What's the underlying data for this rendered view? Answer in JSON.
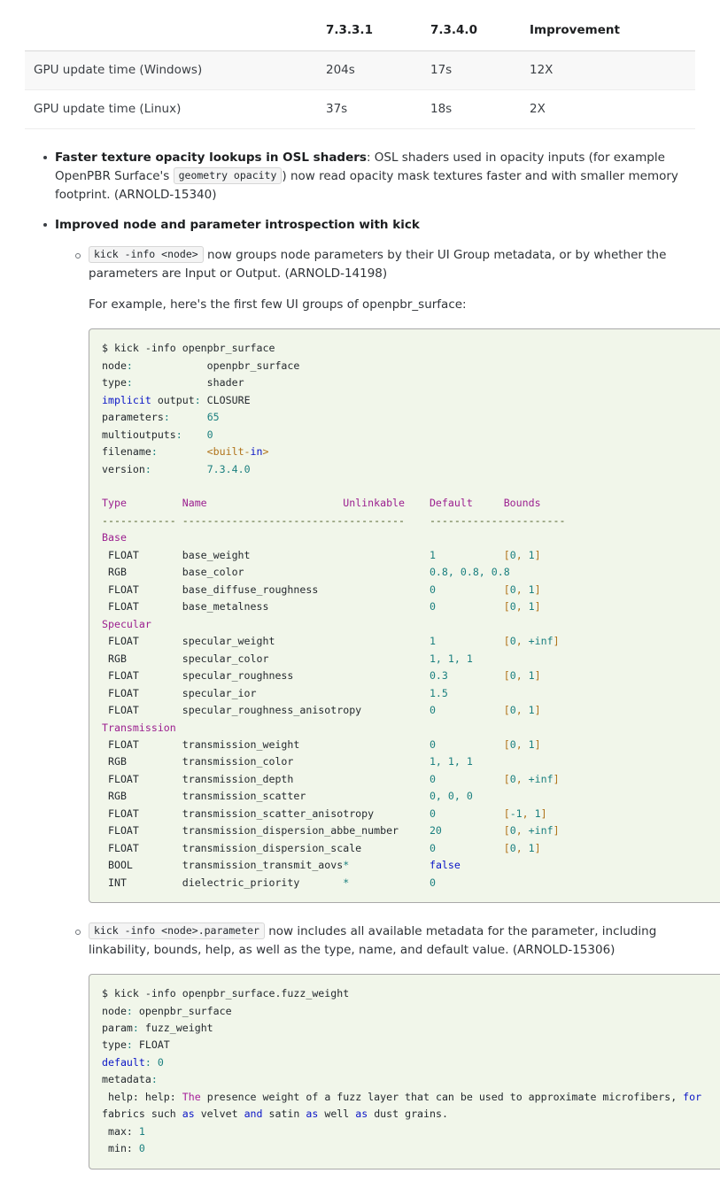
{
  "perf_table": {
    "headers": [
      "",
      "7.3.3.1",
      "7.3.4.0",
      "Improvement"
    ],
    "rows": [
      {
        "label": "GPU update time (Windows)",
        "v1": "204s",
        "v2": "17s",
        "improvement": "12X"
      },
      {
        "label": "GPU update time (Linux)",
        "v1": "37s",
        "v2": "18s",
        "improvement": "2X"
      }
    ]
  },
  "bullets": {
    "item1": {
      "title": "Faster texture opacity lookups in OSL shaders",
      "text_a": ": OSL shaders used in opacity inputs (for example OpenPBR Surface's ",
      "chip": "geometry opacity",
      "text_b": ") now read opacity mask textures faster and with smaller memory footprint. (ARNOLD-15340)"
    },
    "item2": {
      "title": "Improved node and parameter introspection with kick",
      "sub1": {
        "chip": "kick -info <node>",
        "text": " now groups node parameters by their UI Group metadata, or by whether the parameters are Input or Output. (ARNOLD-14198)",
        "para": "For example, here's the first few UI groups of openpbr_surface:"
      },
      "sub2": {
        "chip": "kick -info <node>.parameter",
        "text": " now includes all available metadata for the parameter, including linkability, bounds, help, as well as the type, name, and default value. (ARNOLD-15306)"
      }
    }
  },
  "code_block_1": {
    "command": "$ kick -info openpbr_surface",
    "info": [
      {
        "key": "node:",
        "value": "openpbr_surface",
        "kind": "plain"
      },
      {
        "key": "type:",
        "value": "shader",
        "kind": "plain"
      },
      {
        "key": "implicit output:",
        "value": "CLOSURE",
        "kind": "plain"
      },
      {
        "key": "parameters:",
        "value": "65",
        "kind": "num"
      },
      {
        "key": "multioutputs:",
        "value": "0",
        "kind": "num"
      },
      {
        "key": "filename:",
        "value": "<built-in>",
        "kind": "str"
      },
      {
        "key": "version:",
        "value": "7.3.4.0",
        "kind": "num"
      }
    ],
    "columns": [
      "Type",
      "Name",
      "Unlinkable",
      "Default",
      "Bounds"
    ],
    "rule": [
      "------------",
      "------------------------------------",
      "-------------",
      "---------"
    ],
    "groups": [
      {
        "name": "Base",
        "params": [
          {
            "type": "FLOAT",
            "name": "base_weight",
            "unlinkable": "",
            "default": "1",
            "bounds": "[0, 1]"
          },
          {
            "type": "RGB",
            "name": "base_color",
            "unlinkable": "",
            "default": "0.8, 0.8, 0.8",
            "bounds": ""
          },
          {
            "type": "FLOAT",
            "name": "base_diffuse_roughness",
            "unlinkable": "",
            "default": "0",
            "bounds": "[0, 1]"
          },
          {
            "type": "FLOAT",
            "name": "base_metalness",
            "unlinkable": "",
            "default": "0",
            "bounds": "[0, 1]"
          }
        ]
      },
      {
        "name": "Specular",
        "params": [
          {
            "type": "FLOAT",
            "name": "specular_weight",
            "unlinkable": "",
            "default": "1",
            "bounds": "[0, +inf]"
          },
          {
            "type": "RGB",
            "name": "specular_color",
            "unlinkable": "",
            "default": "1, 1, 1",
            "bounds": ""
          },
          {
            "type": "FLOAT",
            "name": "specular_roughness",
            "unlinkable": "",
            "default": "0.3",
            "bounds": "[0, 1]"
          },
          {
            "type": "FLOAT",
            "name": "specular_ior",
            "unlinkable": "",
            "default": "1.5",
            "bounds": ""
          },
          {
            "type": "FLOAT",
            "name": "specular_roughness_anisotropy",
            "unlinkable": "",
            "default": "0",
            "bounds": "[0, 1]"
          }
        ]
      },
      {
        "name": "Transmission",
        "params": [
          {
            "type": "FLOAT",
            "name": "transmission_weight",
            "unlinkable": "",
            "default": "0",
            "bounds": "[0, 1]"
          },
          {
            "type": "RGB",
            "name": "transmission_color",
            "unlinkable": "",
            "default": "1, 1, 1",
            "bounds": ""
          },
          {
            "type": "FLOAT",
            "name": "transmission_depth",
            "unlinkable": "",
            "default": "0",
            "bounds": "[0, +inf]"
          },
          {
            "type": "RGB",
            "name": "transmission_scatter",
            "unlinkable": "",
            "default": "0, 0, 0",
            "bounds": ""
          },
          {
            "type": "FLOAT",
            "name": "transmission_scatter_anisotropy",
            "unlinkable": "",
            "default": "0",
            "bounds": "[-1, 1]"
          },
          {
            "type": "FLOAT",
            "name": "transmission_dispersion_abbe_number",
            "unlinkable": "",
            "default": "20",
            "bounds": "[0, +inf]"
          },
          {
            "type": "FLOAT",
            "name": "transmission_dispersion_scale",
            "unlinkable": "",
            "default": "0",
            "bounds": "[0, 1]"
          },
          {
            "type": "BOOL",
            "name": "transmission_transmit_aovs",
            "unlinkable": "*",
            "default": "false",
            "bounds": ""
          },
          {
            "type": "INT",
            "name": "dielectric_priority",
            "unlinkable": "*",
            "default": "0",
            "bounds": ""
          }
        ]
      }
    ]
  },
  "code_block_2": {
    "command": "$ kick -info openpbr_surface.fuzz_weight",
    "lines": [
      {
        "key": "node:",
        "value": "openpbr_surface"
      },
      {
        "key": "param:",
        "value": "fuzz_weight"
      },
      {
        "key": "type:",
        "value": "FLOAT"
      },
      {
        "key": "default:",
        "value": "0"
      },
      {
        "key": "metadata:",
        "value": ""
      }
    ],
    "help_key": " help:",
    "help_text": " The presence weight of a fuzz layer that can be used to approximate microfibers, for fabrics such as velvet and satin as well as dust grains.",
    "max_key": " max:",
    "max_value": "1",
    "min_key": " min:",
    "min_value": "0"
  }
}
